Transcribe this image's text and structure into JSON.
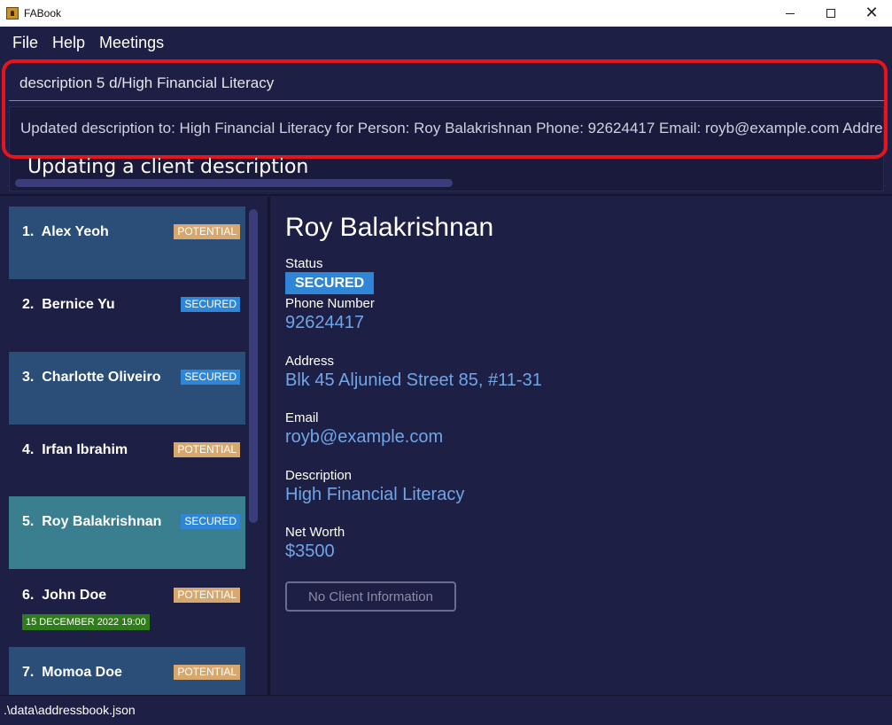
{
  "window": {
    "title": "FABook"
  },
  "menu": [
    "File",
    "Help",
    "Meetings"
  ],
  "command": {
    "value": "description 5 d/High Financial Literacy"
  },
  "result": {
    "text": "Updated description to: High Financial Literacy for Person: Roy Balakrishnan Phone: 92624417 Email: royb@example.com Address: B"
  },
  "annotation": "Updating a client description",
  "clients": [
    {
      "index": "1.",
      "name": "Alex Yeoh",
      "status": "POTENTIAL",
      "meeting": ""
    },
    {
      "index": "2.",
      "name": "Bernice Yu",
      "status": "SECURED",
      "meeting": ""
    },
    {
      "index": "3.",
      "name": "Charlotte Oliveiro",
      "status": "SECURED",
      "meeting": ""
    },
    {
      "index": "4.",
      "name": "Irfan Ibrahim",
      "status": "POTENTIAL",
      "meeting": ""
    },
    {
      "index": "5.",
      "name": "Roy Balakrishnan",
      "status": "SECURED",
      "meeting": ""
    },
    {
      "index": "6.",
      "name": "John Doe",
      "status": "POTENTIAL",
      "meeting": "15 DECEMBER 2022 19:00"
    },
    {
      "index": "7.",
      "name": "Momoa Doe",
      "status": "POTENTIAL",
      "meeting": ""
    }
  ],
  "detail": {
    "name": "Roy Balakrishnan",
    "status_label": "Status",
    "status": "SECURED",
    "phone_label": "Phone Number",
    "phone": "92624417",
    "address_label": "Address",
    "address": "Blk 45 Aljunied Street 85, #11-31",
    "email_label": "Email",
    "email": "royb@example.com",
    "description_label": "Description",
    "description": "High Financial Literacy",
    "networth_label": "Net Worth",
    "networth": "$3500",
    "button": "No Client Information"
  },
  "statusbar": {
    "path": ".\\data\\addressbook.json"
  },
  "colors": {
    "background": "#1e1f44",
    "highlight": "#e8141c",
    "secured": "#2f86d6",
    "potential": "#d7a86e",
    "meeting": "#2f7d1a",
    "accent_text": "#6fa6e8"
  }
}
